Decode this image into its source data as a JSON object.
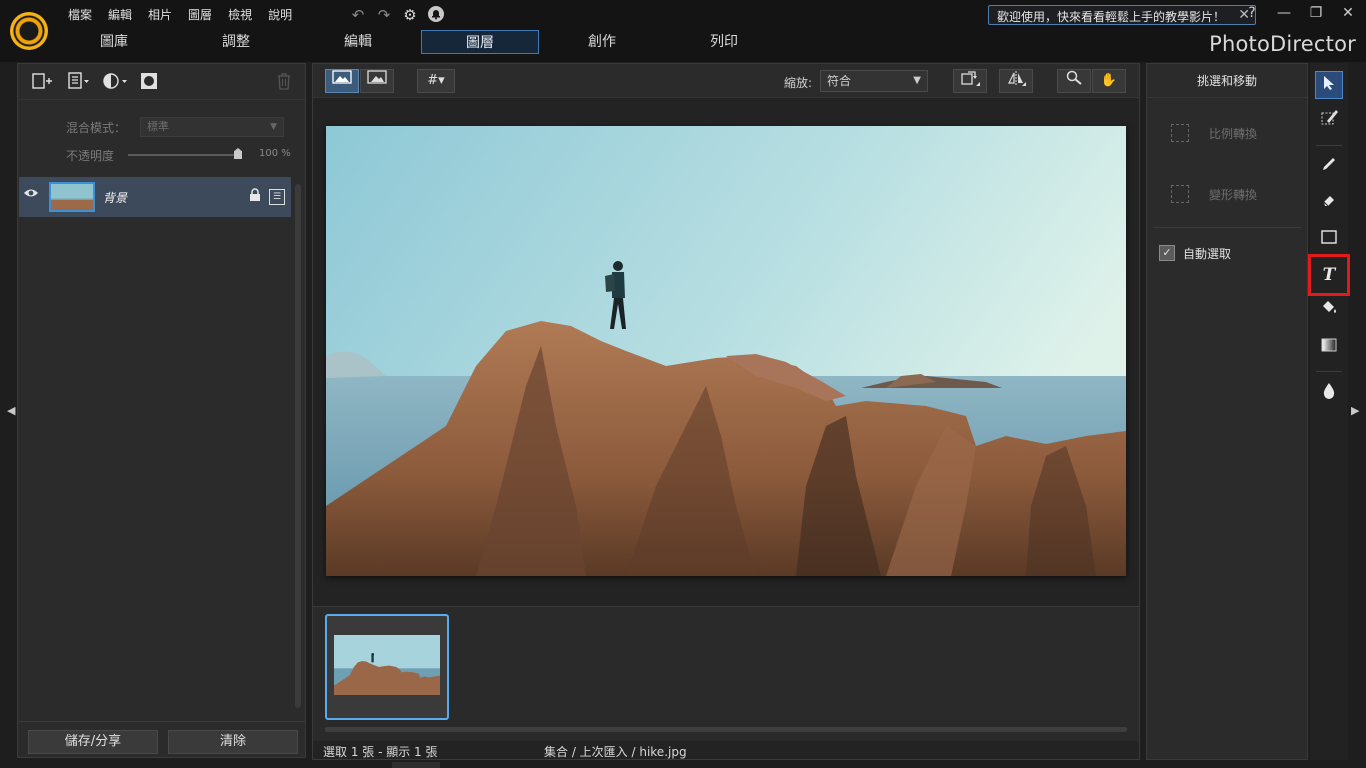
{
  "menu": [
    "檔案",
    "編輯",
    "相片",
    "圖層",
    "檢視",
    "說明"
  ],
  "notification": {
    "text": "歡迎使用，快來看看輕鬆上手的教學影片！",
    "close": "✕"
  },
  "window_controls": {
    "help": "?",
    "minimize": "—",
    "restore": "❐",
    "close": "✕"
  },
  "modes": [
    "圖庫",
    "調整",
    "編輯",
    "圖層",
    "創作",
    "列印"
  ],
  "active_mode": "圖層",
  "brand": "PhotoDirector",
  "layers_panel": {
    "blend_label": "混合模式：",
    "blend_value": "標準",
    "opacity_label": "不透明度",
    "opacity_value": "100 %",
    "opacity_level": 1.0,
    "layer_name": "背景",
    "save_share": "儲存/分享",
    "clear": "清除"
  },
  "canvas_toolbar": {
    "zoom_label": "縮放:",
    "zoom_value": "符合"
  },
  "right_panel": {
    "title": "挑選和移動",
    "scale_transform": "比例轉換",
    "shape_transform": "變形轉換",
    "auto_select": "自動選取",
    "auto_select_checked": true
  },
  "status": {
    "selection": "選取 1 張 - 顯示 1 張",
    "path": "集合 / 上次匯入 / hike.jpg"
  },
  "icons": {
    "undo": "undo-icon",
    "redo": "redo-icon",
    "settings": "gear-icon",
    "notify": "bell-icon",
    "select_tool": "arrow-cursor-icon",
    "text_tool": "text-icon"
  },
  "colors": {
    "accent": "#3d8fd6",
    "highlight": "#e01b1b",
    "active_tab_border": "#3d7ab5"
  }
}
